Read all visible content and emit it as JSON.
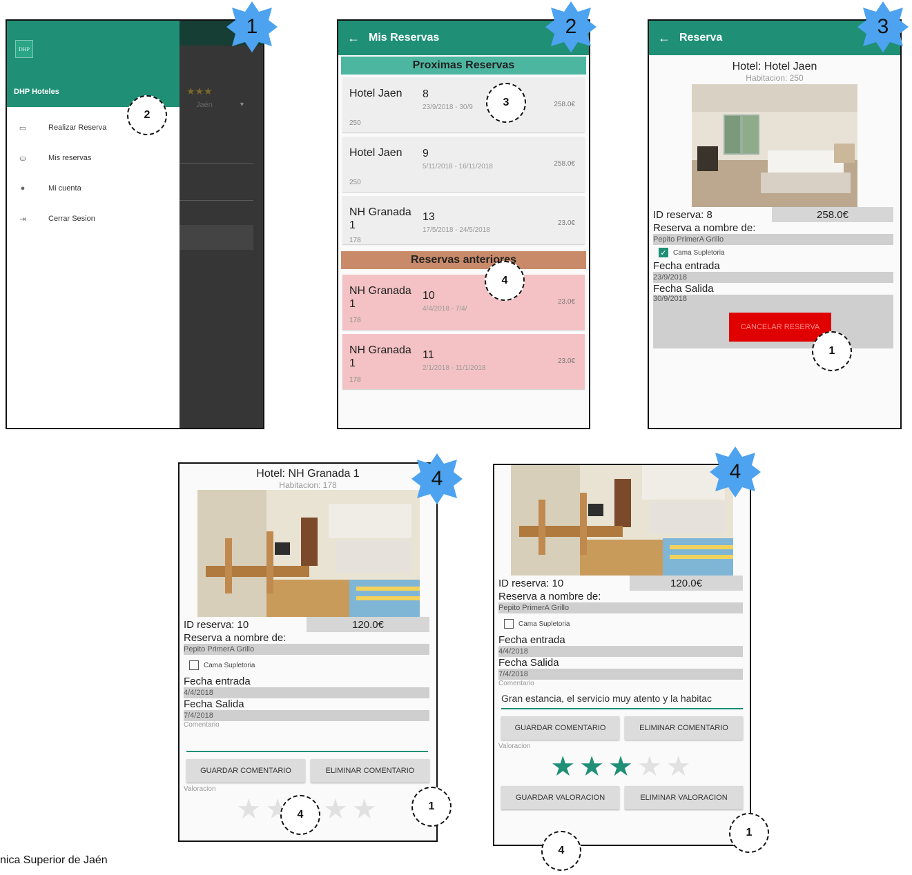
{
  "screen1": {
    "drawer_title": "DHP Hoteles",
    "logo_text": "DHP",
    "menu": [
      {
        "label": "Realizar Reserva",
        "icon": "card-icon"
      },
      {
        "label": "Mis reservas",
        "icon": "hotel-bed-icon"
      },
      {
        "label": "Mi cuenta",
        "icon": "person-icon"
      },
      {
        "label": "Cerrar Sesion",
        "icon": "logout-icon"
      }
    ],
    "behind_stars": "★★★",
    "behind_text": "Jaén"
  },
  "screen2": {
    "title": "Mis Reservas",
    "upcoming_header": "Proximas Reservas",
    "past_header": "Reservas anteriores",
    "upcoming": [
      {
        "hotel": "Hotel Jaen",
        "room": "250",
        "id": "8",
        "dates": "23/9/2018 - 30/9",
        "price": "258.0€"
      },
      {
        "hotel": "Hotel Jaen",
        "room": "250",
        "id": "9",
        "dates": "5/11/2018 - 16/11/2018",
        "price": "258.0€"
      },
      {
        "hotel": "NH Granada 1",
        "room": "178",
        "id": "13",
        "dates": "17/5/2018 - 24/5/2018",
        "price": "23.0€"
      }
    ],
    "past": [
      {
        "hotel": "NH Granada 1",
        "room": "178",
        "id": "10",
        "dates": "4/4/2018 - 7/4/",
        "price": "23.0€"
      },
      {
        "hotel": "NH Granada 1",
        "room": "178",
        "id": "11",
        "dates": "2/1/2018 - 11/1/2018",
        "price": "23.0€"
      }
    ]
  },
  "screen3": {
    "title": "Reserva",
    "hotel": "Hotel: Hotel Jaen",
    "room": "Habitacion: 250",
    "id_label": "ID reserva: 8",
    "price": "258.0€",
    "name_label": "Reserva a nombre de:",
    "name_value": "Pepito PrimerA Grillo",
    "extra_bed": "Cama Supletoria",
    "checkin_label": "Fecha entrada",
    "checkin_value": "23/9/2018",
    "checkout_label": "Fecha Salida",
    "checkout_value": "30/9/2018",
    "cancel_button": "CANCELAR RESERVA"
  },
  "screen4a": {
    "hotel": "Hotel: NH Granada 1",
    "room": "Habitacion: 178",
    "id_label": "ID reserva: 10",
    "price": "120.0€",
    "name_label": "Reserva a nombre de:",
    "name_value": "Pepito PrimerA Grillo",
    "extra_bed": "Cama Supletoria",
    "checkin_label": "Fecha entrada",
    "checkin_value": "4/4/2018",
    "checkout_label": "Fecha Salida",
    "checkout_value": "7/4/2018",
    "comment_label": "Comentario",
    "save_comment": "GUARDAR COMENTARIO",
    "delete_comment": "ELIMINAR COMENTARIO",
    "rating_label": "Valoracion",
    "rating": 0
  },
  "screen4b": {
    "id_label": "ID reserva: 10",
    "price": "120.0€",
    "name_label": "Reserva a nombre de:",
    "name_value": "Pepito PrimerA Grillo",
    "extra_bed": "Cama Supletoria",
    "checkin_label": "Fecha entrada",
    "checkin_value": "4/4/2018",
    "checkout_label": "Fecha Salida",
    "checkout_value": "7/4/2018",
    "comment_label": "Comentario",
    "comment_value": "Gran estancia, el servicio muy atento y la habitac",
    "save_comment": "GUARDAR COMENTARIO",
    "delete_comment": "ELIMINAR COMENTARIO",
    "rating_label": "Valoracion",
    "rating": 3,
    "save_rating": "GUARDAR VALORACION",
    "delete_rating": "ELIMINAR VALORACION"
  },
  "badges": {
    "step1": "1",
    "step2": "2",
    "step3": "3",
    "step4a": "4",
    "step4b": "4"
  },
  "callouts": {
    "s1_a": "2",
    "s2_a": "3",
    "s2_b": "4",
    "s3_a": "1",
    "s4a_a": "4",
    "s4a_b": "1",
    "s4b_a": "1",
    "s4b_b": "4"
  },
  "footer": "nica Superior de Jaén",
  "colors": {
    "primary": "#1f8f76",
    "upcoming": "#4db6a1",
    "past": "#c98a6a",
    "cancel": "#e00000"
  }
}
